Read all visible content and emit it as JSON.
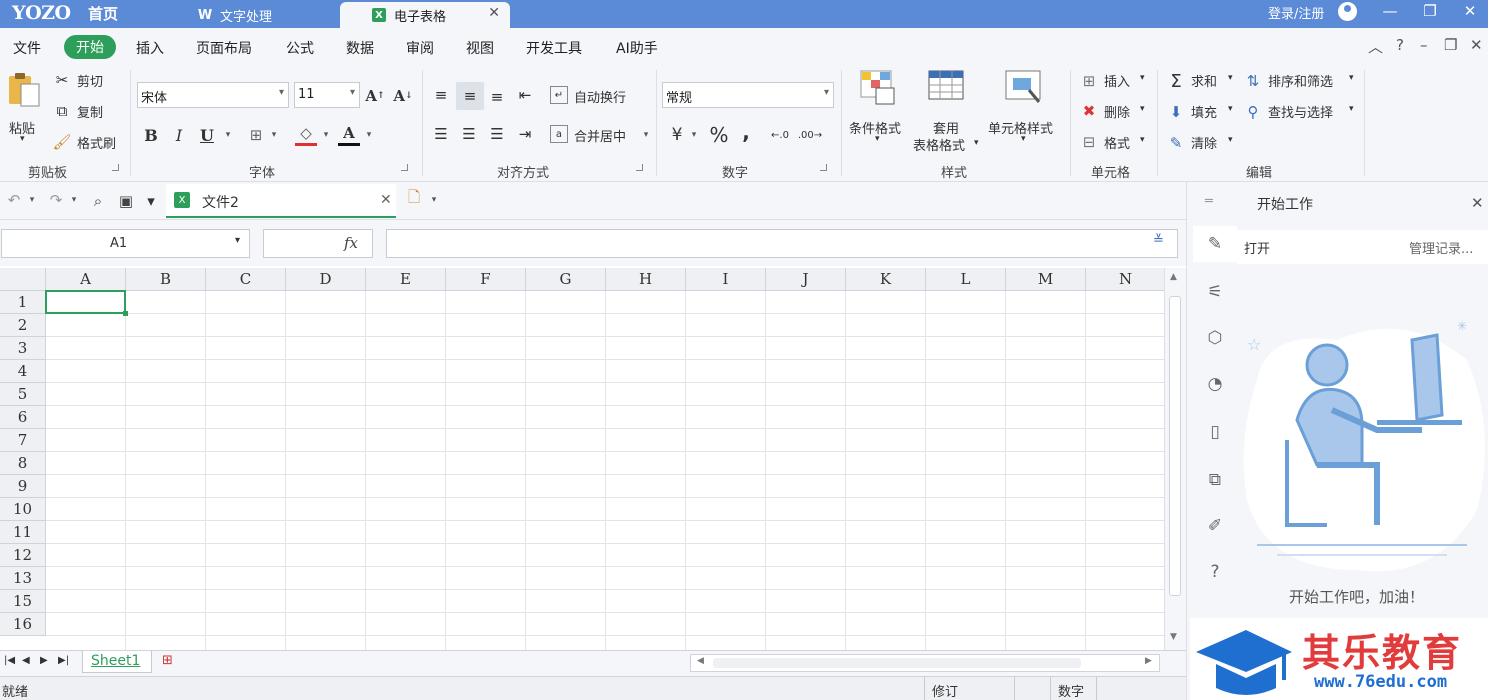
{
  "titlebar": {
    "logo": "YOZO",
    "home": "首页",
    "tabs": [
      {
        "label": "文字处理",
        "icon": "writer-icon"
      },
      {
        "label": "电子表格",
        "icon": "spreadsheet-icon"
      }
    ],
    "login": "登录/注册"
  },
  "menu": {
    "items": [
      "文件",
      "开始",
      "插入",
      "页面布局",
      "公式",
      "数据",
      "审阅",
      "视图",
      "开发工具",
      "AI助手"
    ],
    "active": "开始"
  },
  "ribbon": {
    "clipboard": {
      "paste": "粘贴",
      "cut": "剪切",
      "copy": "复制",
      "format_painter": "格式刷",
      "group": "剪贴板"
    },
    "font": {
      "name": "宋体",
      "size": "11",
      "bold": "B",
      "italic": "I",
      "underline": "U",
      "group": "字体"
    },
    "alignment": {
      "wrap": "自动换行",
      "merge": "合并居中",
      "group": "对齐方式"
    },
    "number": {
      "format": "常规",
      "percent": "%",
      "comma": ",",
      "group": "数字"
    },
    "styles": {
      "conditional": "条件格式",
      "table_line1": "套用",
      "table_line2": "表格格式",
      "cell_style": "单元格样式",
      "group": "样式"
    },
    "cells": {
      "insert": "插入",
      "delete": "删除",
      "format": "格式",
      "group": "单元格"
    },
    "editing": {
      "sum": "求和",
      "fill": "填充",
      "clear": "清除",
      "sort": "排序和筛选",
      "find": "查找与选择",
      "group": "编辑"
    }
  },
  "doc_tab": {
    "label": "文件2"
  },
  "formula": {
    "cell_ref": "A1",
    "fx": "fx",
    "value": ""
  },
  "grid": {
    "columns": [
      "A",
      "B",
      "C",
      "D",
      "E",
      "F",
      "G",
      "H",
      "I",
      "J",
      "K",
      "L",
      "M",
      "N"
    ],
    "rows": [
      "1",
      "2",
      "3",
      "4",
      "5",
      "6",
      "7",
      "8",
      "9",
      "10",
      "11",
      "12",
      "13",
      "15",
      "16"
    ]
  },
  "sheets": {
    "tabs": [
      "Sheet1"
    ]
  },
  "status": {
    "ready": "就绪",
    "revise": "修订",
    "number": "数字"
  },
  "panel": {
    "title": "开始工作",
    "open": "打开",
    "manage": "管理记录...",
    "message": "开始工作吧，加油！"
  },
  "watermark": {
    "brand": "其乐教育",
    "url": "www.76edu.com"
  },
  "colors": {
    "accent": "#2d9f5a",
    "titlebar": "#5b8ad6",
    "watermark_red": "#e23b3b",
    "watermark_blue": "#1f6fd1"
  }
}
